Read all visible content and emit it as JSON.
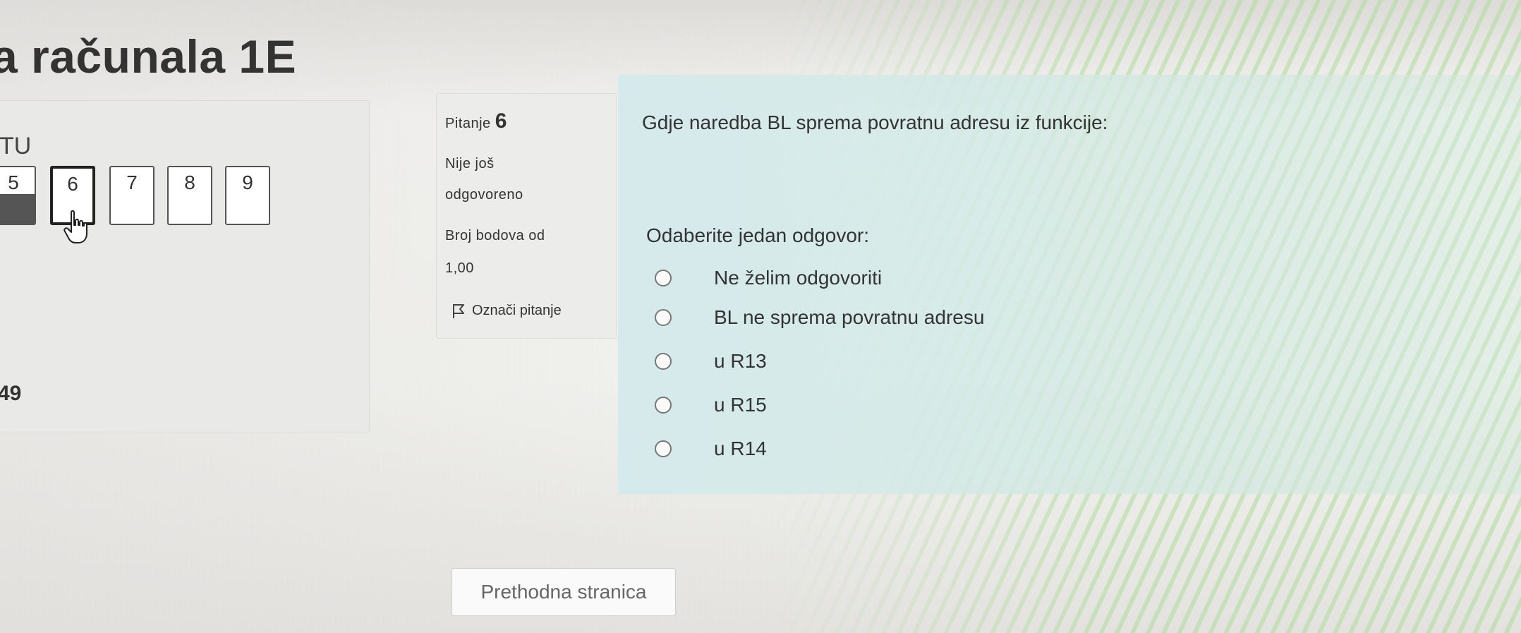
{
  "page": {
    "title": "a računala 1E"
  },
  "nav": {
    "heading": "TU",
    "buttons": [
      {
        "label": "5",
        "state": "answered"
      },
      {
        "label": "6",
        "state": "current"
      },
      {
        "label": "7",
        "state": "unanswered"
      },
      {
        "label": "8",
        "state": "unanswered"
      },
      {
        "label": "9",
        "state": "unanswered"
      }
    ],
    "timer": "49"
  },
  "info": {
    "question_label": "Pitanje",
    "question_number": "6",
    "status_line1": "Nije još",
    "status_line2": "odgovoreno",
    "points_line1": "Broj bodova od",
    "points_line2": "1,00",
    "flag_label": "Označi pitanje"
  },
  "question": {
    "text": "Gdje naredba BL sprema povratnu adresu iz funkcije:",
    "prompt": "Odaberite jedan odgovor:",
    "options": [
      "Ne želim odgovoriti",
      "BL ne sprema povratnu adresu",
      "u R13",
      "u R15",
      "u R14"
    ]
  },
  "footer": {
    "prev_button": "Prethodna stranica"
  },
  "colors": {
    "content_bg": "#d4eaec",
    "answered_fill": "#555555",
    "stripe_green": "#afdc9b"
  },
  "icons": {
    "cursor": "hand-pointer-icon",
    "flag": "flag-icon",
    "radio": "radio-icon"
  }
}
